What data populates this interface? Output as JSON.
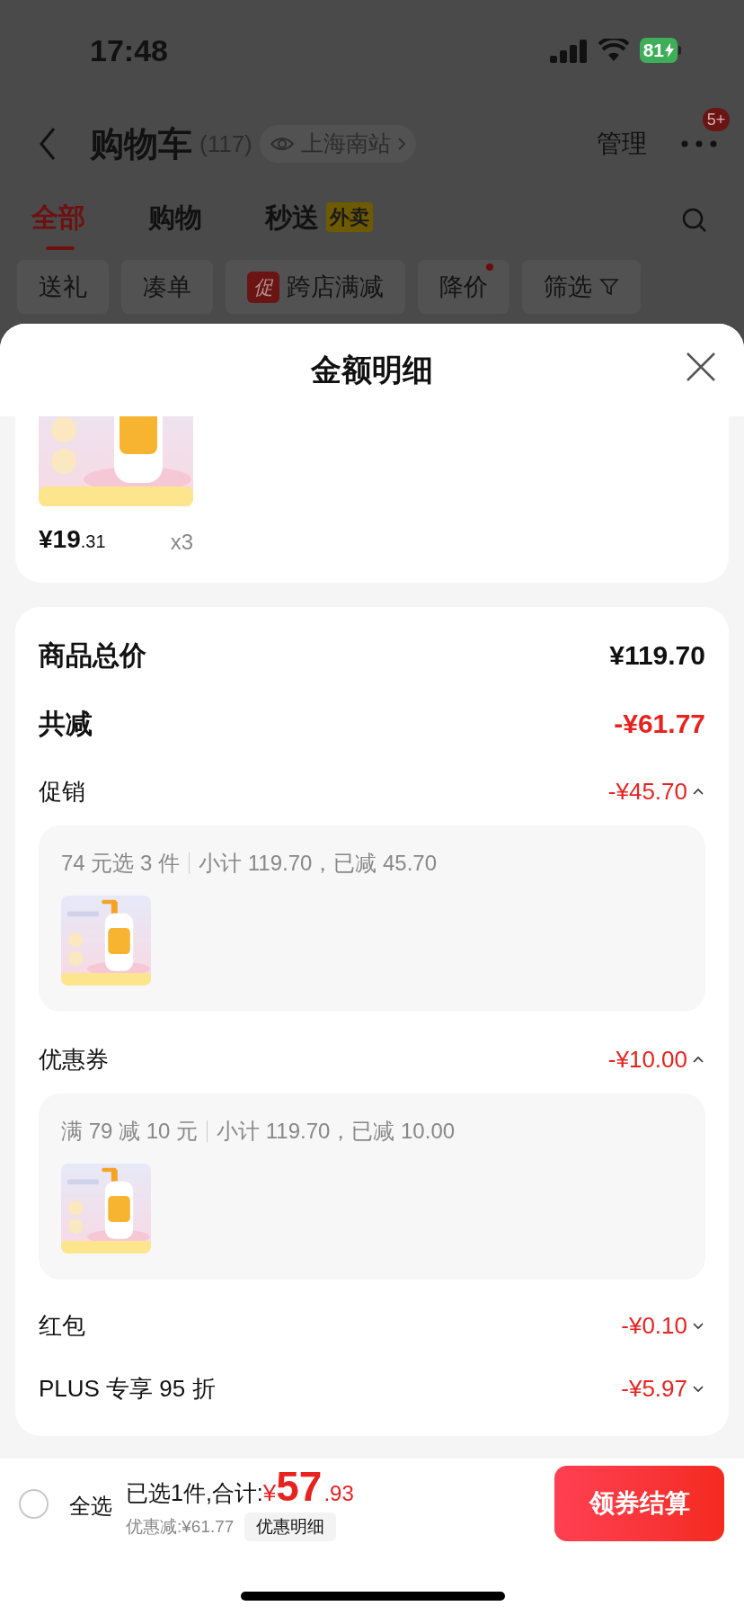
{
  "status_bar": {
    "time": "17:48",
    "battery": "81"
  },
  "header": {
    "title": "购物车",
    "count": "(117)",
    "location": "上海南站",
    "manage": "管理",
    "badge": "5+"
  },
  "tabs": [
    {
      "label": "全部",
      "selected": true
    },
    {
      "label": "购物",
      "selected": false
    },
    {
      "label": "秒送",
      "tag": "外卖",
      "selected": false
    }
  ],
  "filters": [
    {
      "label": "送礼",
      "kind": "plain",
      "dot": false
    },
    {
      "label": "凑单",
      "kind": "plain",
      "dot": false
    },
    {
      "label": "跨店满减",
      "kind": "promo",
      "tag": "促",
      "dot": false
    },
    {
      "label": "降价",
      "kind": "plain",
      "dot": true
    },
    {
      "label": "筛选",
      "kind": "filter",
      "dot": false
    }
  ],
  "sheet": {
    "title": "金额明细",
    "product": {
      "price": "¥19",
      "price_decimal": ".31",
      "quantity": "x3"
    },
    "rows": [
      {
        "kind": "total",
        "label": "商品总价",
        "value": "¥119.70",
        "highlight": false
      },
      {
        "kind": "total",
        "label": "共减",
        "value": "-¥61.77",
        "highlight": true
      },
      {
        "kind": "discount",
        "label": "促销",
        "value": "-¥45.70",
        "expanded": true,
        "rule": "74 元选 3 件",
        "detail": "小计 119.70，已减 45.70"
      },
      {
        "kind": "discount",
        "label": "优惠券",
        "value": "-¥10.00",
        "expanded": true,
        "rule": "满 79 减 10 元",
        "detail": "小计 119.70，已减 10.00"
      },
      {
        "kind": "discount",
        "label": "红包",
        "value": "-¥0.10",
        "expanded": false
      },
      {
        "kind": "discount",
        "label": "PLUS 专享 95 折",
        "value": "-¥5.97",
        "expanded": false
      }
    ]
  },
  "bottom_bar": {
    "select_all": {
      "label": "全选",
      "checked": false
    },
    "summary": "已选1件,合计:",
    "currency": "¥",
    "amount": "57",
    "amount_decimal": ".93",
    "discount": "优惠减:¥61.77",
    "detail_button": "优惠明细",
    "checkout": "领券结算"
  }
}
